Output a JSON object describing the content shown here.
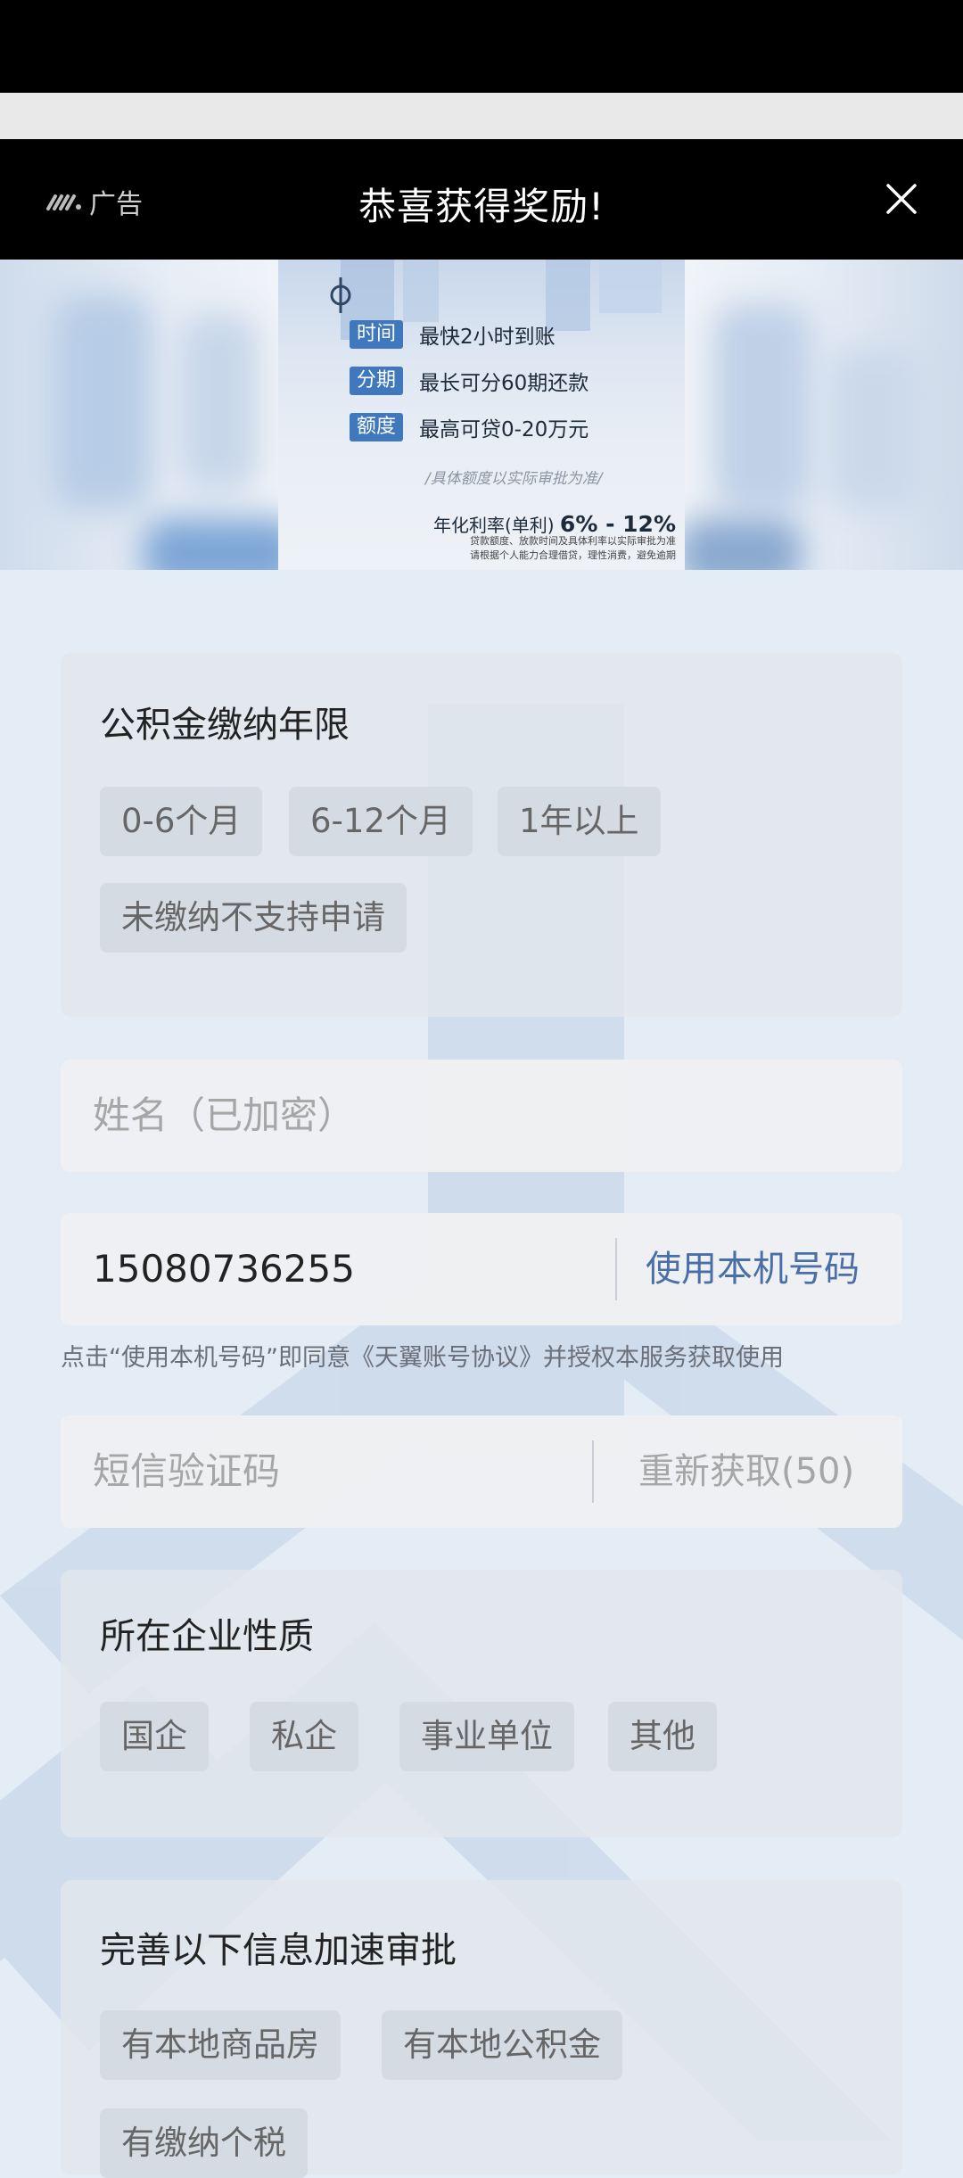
{
  "ad_bar": {
    "badge_label": "广告",
    "title": "恭喜获得奖励!",
    "close_icon": "close-icon"
  },
  "banner": {
    "rows": [
      {
        "tag": "时间",
        "text": "最快2小时到账"
      },
      {
        "tag": "分期",
        "text": "最长可分60期还款"
      },
      {
        "tag": "额度",
        "text": "最高可贷0-20万元"
      }
    ],
    "note": "/具体额度以实际审批为准/",
    "rate_label": "年化利率(单利)",
    "rate_value": "6% - 12%",
    "small_line1": "贷款额度、放款时间及具体利率以实际审批为准",
    "small_line2": "请根据个人能力合理借贷，理性消费，避免逾期"
  },
  "fund_years": {
    "title": "公积金缴纳年限",
    "options": [
      "0-6个月",
      "6-12个月",
      "1年以上",
      "未缴纳不支持申请"
    ]
  },
  "name_field": {
    "placeholder": "姓名（已加密）"
  },
  "phone_field": {
    "value": "15080736255",
    "action": "使用本机号码"
  },
  "consent_text": "点击“使用本机号码”即同意《天翼账号协议》并授权本服务获取使用",
  "sms_field": {
    "placeholder": "短信验证码",
    "action": "重新获取(50)"
  },
  "company_type": {
    "title": "所在企业性质",
    "options": [
      "国企",
      "私企",
      "事业单位",
      "其他"
    ]
  },
  "extra_info": {
    "title": "完善以下信息加速审批",
    "options": [
      "有本地商品房",
      "有本地公积金",
      "有缴纳个税"
    ]
  },
  "colors": {
    "accent": "#4a6fa5",
    "banner_tag": "#3f78bd",
    "ad_bar": "#000000"
  }
}
